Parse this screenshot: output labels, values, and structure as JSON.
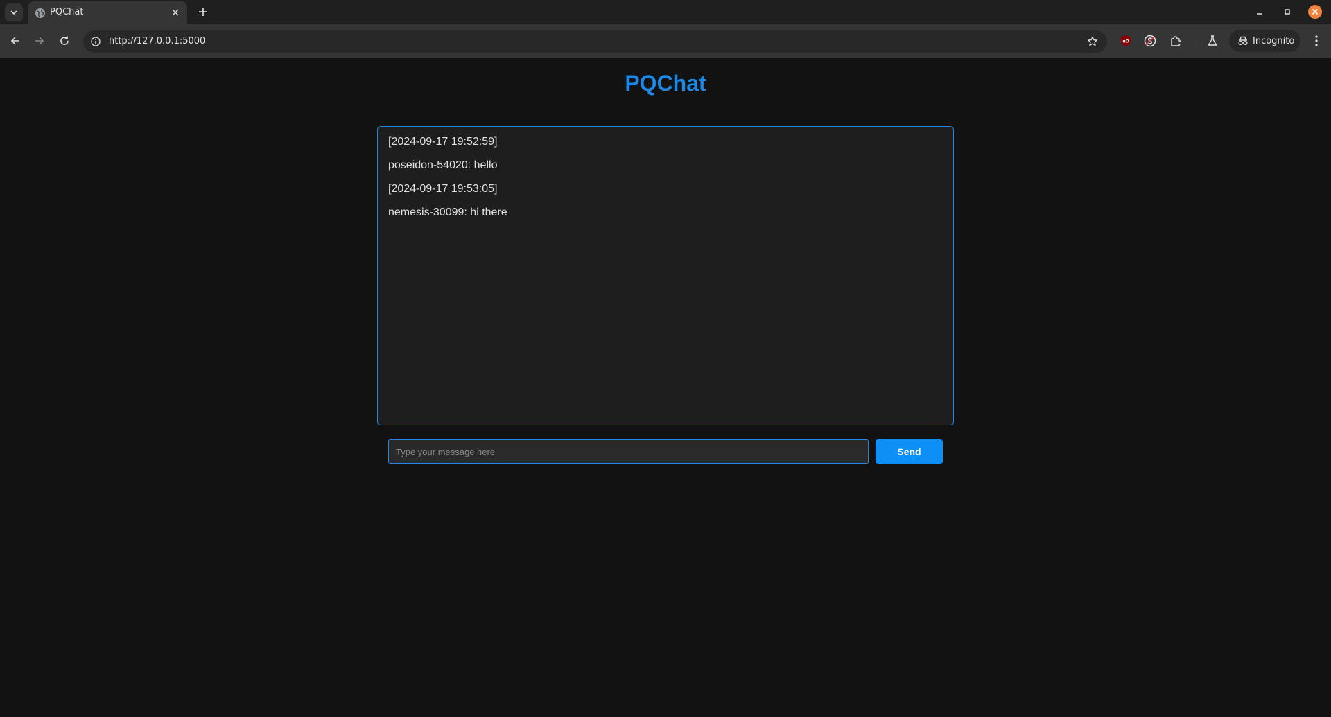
{
  "browser": {
    "tab": {
      "title": "PQChat"
    },
    "address_bar": {
      "url": "http://127.0.0.1:5000"
    },
    "profile": {
      "label": "Incognito"
    },
    "icons": [
      "tab-search-icon",
      "globe-icon",
      "close-icon",
      "plus-icon",
      "minimize-icon",
      "maximize-icon",
      "window-close-icon",
      "back-icon",
      "forward-icon",
      "reload-icon",
      "info-icon",
      "star-icon",
      "ublock-icon",
      "extension-s-icon",
      "puzzle-icon",
      "labs-flask-icon",
      "incognito-icon",
      "kebab-menu-icon"
    ]
  },
  "app": {
    "title": "PQChat",
    "accent_color": "#1e88e5",
    "messages": [
      {
        "text": "[2024-09-17 19:52:59]"
      },
      {
        "text": "poseidon-54020: hello"
      },
      {
        "text": "[2024-09-17 19:53:05]"
      },
      {
        "text": "nemesis-30099: hi there"
      }
    ],
    "input": {
      "placeholder": "Type your message here",
      "value": ""
    },
    "send_label": "Send"
  }
}
